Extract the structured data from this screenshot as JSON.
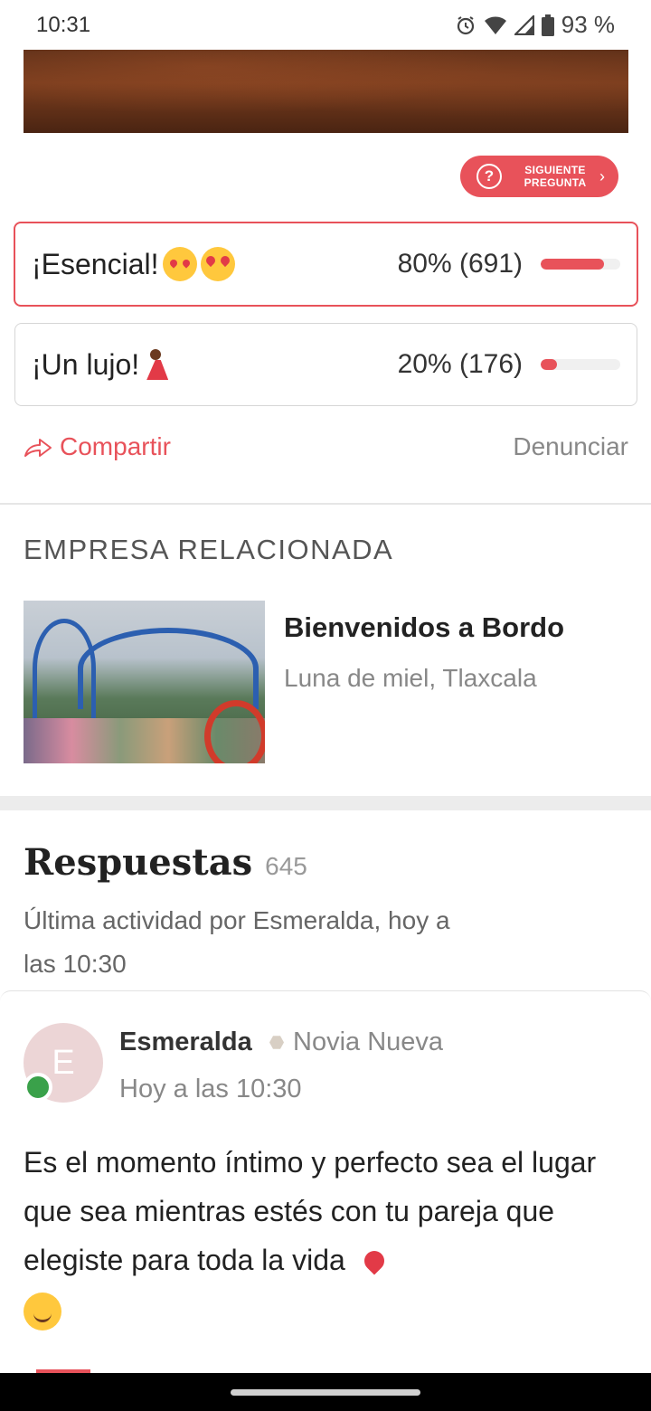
{
  "status_bar": {
    "time": "10:31",
    "battery": "93 %",
    "icons": [
      "alarm-icon",
      "wifi-icon",
      "signal-icon",
      "battery-icon"
    ]
  },
  "next_question": {
    "label": "SIGUIENTE PREGUNTA",
    "icon": "question-icon",
    "chevron": "›"
  },
  "poll": {
    "options": [
      {
        "label": "¡Esencial!",
        "result": "80% (691)",
        "percent": 80,
        "selected": true
      },
      {
        "label": "¡Un lujo!",
        "result": "20% (176)",
        "percent": 20,
        "selected": false
      }
    ]
  },
  "actions": {
    "share": "Compartir",
    "report": "Denunciar"
  },
  "related": {
    "section_title": "EMPRESA RELACIONADA",
    "name": "Bienvenidos a Bordo",
    "subtitle": "Luna de miel, Tlaxcala"
  },
  "answers": {
    "title": "Respuestas",
    "count": "645",
    "last_activity": "Última actividad por Esmeralda, hoy a las 10:30"
  },
  "post": {
    "avatar_initial": "E",
    "author": "Esmeralda",
    "badge": "Novia Nueva",
    "time": "Hoy a las 10:30",
    "body": "Es el momento íntimo y perfecto sea el lugar que sea mientras estés con tu pareja que elegiste para toda la vida"
  },
  "colors": {
    "accent": "#e8525a",
    "online": "#3aa14a"
  }
}
